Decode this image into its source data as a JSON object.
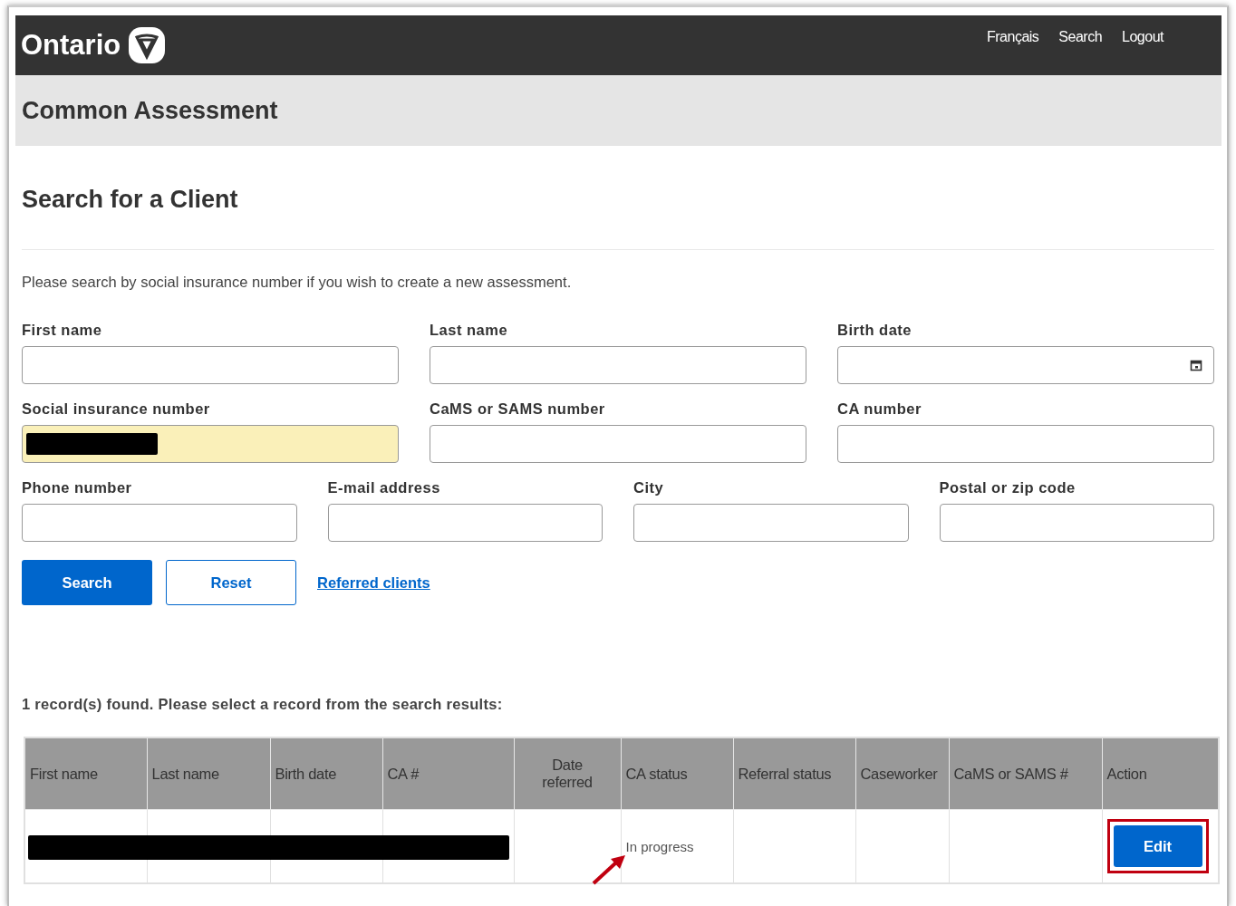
{
  "header": {
    "logo": "Ontario",
    "links": [
      "Français",
      "Search",
      "Logout"
    ]
  },
  "banner": {
    "title": "Common Assessment"
  },
  "page": {
    "heading": "Search for a Client",
    "intro": "Please search by social insurance number if you wish to create a new assessment."
  },
  "field_rows": [
    [
      {
        "label": "First name",
        "kind": "text"
      },
      {
        "label": "Last name",
        "kind": "text"
      },
      {
        "label": "Birth date",
        "kind": "date"
      }
    ],
    [
      {
        "label": "Social insurance number",
        "kind": "text",
        "autofilled": true,
        "redacted": true
      },
      {
        "label": "CaMS or SAMS number",
        "kind": "text"
      },
      {
        "label": "CA number",
        "kind": "text"
      }
    ],
    [
      {
        "label": "Phone number",
        "kind": "text"
      },
      {
        "label": "E-mail address",
        "kind": "text"
      },
      {
        "label": "City",
        "kind": "text"
      },
      {
        "label": "Postal or zip code",
        "kind": "text"
      }
    ]
  ],
  "actions": [
    {
      "label": "Search",
      "kind": "primary"
    },
    {
      "label": "Reset",
      "kind": "secondary"
    },
    {
      "label": "Referred clients",
      "kind": "link"
    }
  ],
  "results": {
    "summary": "1 record(s) found. Please select a record from the search results:",
    "columns": [
      {
        "label": "First name",
        "kind": "plain"
      },
      {
        "label": "Last name",
        "kind": "plain"
      },
      {
        "label": "Birth date",
        "kind": "plain"
      },
      {
        "label": "CA #",
        "kind": "plain"
      },
      {
        "label": "Date referred",
        "kind": "wrapped"
      },
      {
        "label": "CA status",
        "kind": "plain"
      },
      {
        "label": "Referral status",
        "kind": "plain"
      },
      {
        "label": "Caseworker",
        "kind": "plain"
      },
      {
        "label": "CaMS or SAMS #",
        "kind": "plain"
      },
      {
        "label": "Action",
        "kind": "plain"
      }
    ],
    "rows": [
      {
        "redacted": true,
        "ca_status": "In progress",
        "ca_status_arrow": true,
        "action": "Edit",
        "action_highlighted": true
      }
    ]
  }
}
